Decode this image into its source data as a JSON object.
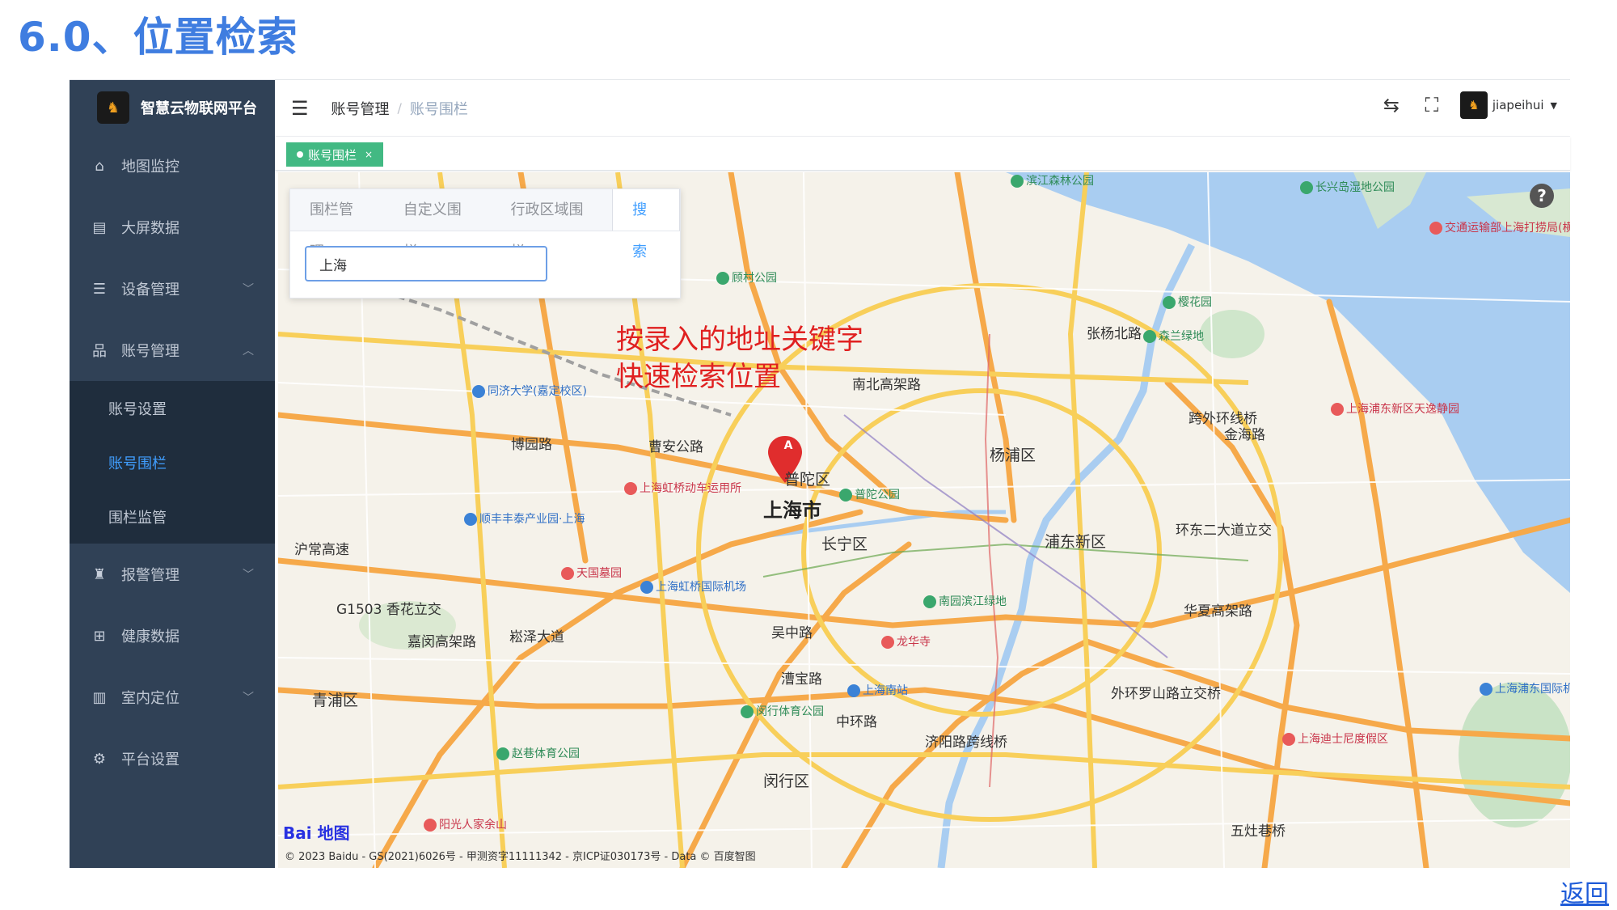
{
  "slide": {
    "title": "6.0、位置检索",
    "back_link": "返回"
  },
  "sidebar": {
    "brand": "智慧云物联网平台",
    "items": [
      {
        "label": "地图监控",
        "icon": "home-icon"
      },
      {
        "label": "大屏数据",
        "icon": "chart-icon"
      },
      {
        "label": "设备管理",
        "icon": "server-icon",
        "expandable": true
      },
      {
        "label": "账号管理",
        "icon": "org-icon",
        "expandable": true,
        "expanded": true
      },
      {
        "label": "报警管理",
        "icon": "alarm-icon",
        "expandable": true
      },
      {
        "label": "健康数据",
        "icon": "medkit-icon"
      },
      {
        "label": "室内定位",
        "icon": "map-icon",
        "expandable": true
      },
      {
        "label": "平台设置",
        "icon": "gear-icon"
      }
    ],
    "submenu": [
      {
        "label": "账号设置"
      },
      {
        "label": "账号围栏",
        "active": true
      },
      {
        "label": "围栏监管"
      }
    ]
  },
  "header": {
    "breadcrumb": [
      "账号管理",
      "账号围栏"
    ],
    "breadcrumb_sep": "/",
    "username": "jiapeihui"
  },
  "tags": [
    {
      "label": "账号围栏",
      "close": "×"
    }
  ],
  "panel": {
    "tabs": [
      {
        "label": "围栏管理"
      },
      {
        "label": "自定义围栏"
      },
      {
        "label": "行政区域围栏"
      },
      {
        "label": "搜索",
        "active": true
      }
    ],
    "search_value": "上海"
  },
  "annotation": {
    "line1": "按录入的地址关键字",
    "line2": "快速检索位置"
  },
  "map": {
    "city_label": "上海市",
    "marker": "A",
    "districts": [
      "普陀区",
      "长宁区",
      "杨浦区",
      "浦东新区",
      "闵行区",
      "青浦区"
    ],
    "roads": [
      "曹安公路",
      "博园路",
      "沪常高速",
      "嘉闵高架路",
      "崧泽大道",
      "吴中路",
      "漕宝路",
      "中环路",
      "济阳路跨线桥",
      "华夏高架路",
      "金海路",
      "跨外环线桥",
      "环东二大道立交",
      "南北高架路",
      "张杨北路",
      "五灶巷桥",
      "外环罗山路立交桥",
      "G1503 香花立交"
    ],
    "pois": [
      {
        "label": "上海虹桥动车运用所",
        "kind": "red"
      },
      {
        "label": "上海虹桥国际机场",
        "kind": "blue"
      },
      {
        "label": "上海南站",
        "kind": "blue"
      },
      {
        "label": "龙华寺",
        "kind": "red"
      },
      {
        "label": "南园滨江绿地",
        "kind": "green"
      },
      {
        "label": "普陀公园",
        "kind": "green"
      },
      {
        "label": "同济大学(嘉定校区)",
        "kind": "blue"
      },
      {
        "label": "顺丰丰泰产业园·上海",
        "kind": "blue"
      },
      {
        "label": "天国墓园",
        "kind": "red"
      },
      {
        "label": "赵巷体育公园",
        "kind": "green"
      },
      {
        "label": "闵行体育公园",
        "kind": "green"
      },
      {
        "label": "阳光人家余山",
        "kind": "red"
      },
      {
        "label": "上海迪士尼度假区",
        "kind": "red"
      },
      {
        "label": "上海浦东国际机场",
        "kind": "blue"
      },
      {
        "label": "森兰绿地",
        "kind": "green"
      },
      {
        "label": "樱花园",
        "kind": "green"
      },
      {
        "label": "顾村公园",
        "kind": "green"
      },
      {
        "label": "滨江森林公园",
        "kind": "green"
      },
      {
        "label": "长兴岛湿地公园",
        "kind": "green"
      },
      {
        "label": "上海浦东新区天逸静园",
        "kind": "red"
      },
      {
        "label": "交通运输部上海打捞局(横沙)",
        "kind": "red"
      }
    ],
    "copyright": "© 2023 Baidu - GS(2021)6026号 - 甲测资字11111342 - 京ICP证030173号 - Data © 百度智图",
    "logo_text": "Bai",
    "logo_suffix": "地图",
    "help": "?"
  }
}
